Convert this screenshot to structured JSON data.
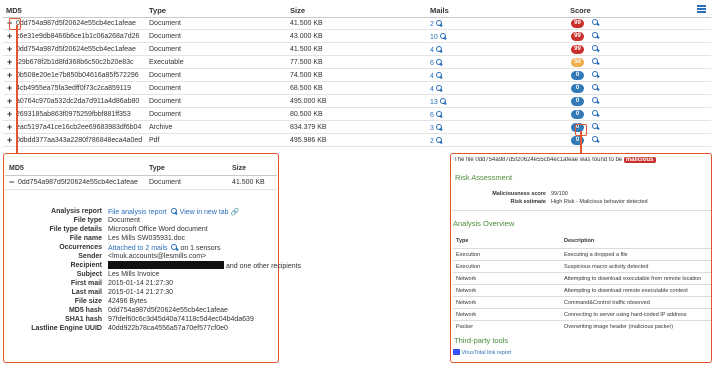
{
  "table": {
    "headers": {
      "md5": "MD5",
      "type": "Type",
      "size": "Size",
      "mails": "Mails",
      "score": "Score"
    },
    "rows": [
      {
        "md5": "0dd754a987d5f20624e55cb4ec1afeae",
        "type": "Document",
        "size": "41.500 KB",
        "mails": "2",
        "score": "99"
      },
      {
        "md5": "c6e31e9db8466b6ce1b1c06a268a7d26",
        "type": "Document",
        "size": "43.000 KB",
        "mails": "10",
        "score": "99"
      },
      {
        "md5": "0dd754a987d5f20624e55cb4ec1afeae",
        "type": "Document",
        "size": "41.500 KB",
        "mails": "4",
        "score": "99"
      },
      {
        "md5": "f29b678f2b1d8fd368b6c50c2b20e83c",
        "type": "Executable",
        "size": "77.500 KB",
        "mails": "6",
        "score": "50"
      },
      {
        "md5": "0b508e20e1e7b850b04616a85f572296",
        "type": "Document",
        "size": "74.500 KB",
        "mails": "4",
        "score": "0"
      },
      {
        "md5": "4cb4955ea75fa3edff0f73c2ca859119",
        "type": "Document",
        "size": "68.500 KB",
        "mails": "4",
        "score": "0"
      },
      {
        "md5": "a0764c970a532dc2da7d911a4d86ab80",
        "type": "Document",
        "size": "495.000 KB",
        "mails": "13",
        "score": "0"
      },
      {
        "md5": "2693185ab863f0975259fbbf881ff353",
        "type": "Document",
        "size": "80.500 KB",
        "mails": "6",
        "score": "0"
      },
      {
        "md5": "eac5197a41ce16cb2ee69683983df6b04",
        "type": "Archive",
        "size": "834.379 KB",
        "mails": "3",
        "score": "0"
      },
      {
        "md5": "0dbdd377aa343a2280f786848eca4a0ed",
        "type": "Pdf",
        "size": "495.986 KB",
        "mails": "2",
        "score": "0"
      }
    ]
  },
  "detail": {
    "headers": {
      "md5": "MD5",
      "type": "Type",
      "size": "Size"
    },
    "row": {
      "md5": "0dd754a987d5f20624e55cb4ec1afeae",
      "type": "Document",
      "size": "41.500 KB"
    },
    "analysis_report_label": "Analysis report",
    "analysis_report_link": "File analysis report",
    "view_new_tab": "View in new tab",
    "fields": [
      {
        "label": "File type",
        "value": "Document"
      },
      {
        "label": "File type details",
        "value": "Microsoft Office Word document"
      },
      {
        "label": "File name",
        "value": "Les Mills SW035931.doc"
      }
    ],
    "occurrences_label": "Occurrences",
    "occurrences_link": "Attached to 2 mails",
    "occurrences_suffix": "on 1 sensors",
    "sender_label": "Sender",
    "sender_value": "<lmuk.accounts@lesmills.com>",
    "recipient_label": "Recipient",
    "recipient_suffix": "and one other recipients",
    "fields2": [
      {
        "label": "Subject",
        "value": "Les Mills Invoice"
      },
      {
        "label": "First mail",
        "value": "2015-01-14 21:27:30"
      },
      {
        "label": "Last mail",
        "value": "2015-01-14 21:27:30"
      },
      {
        "label": "File size",
        "value": "42496 Bytes"
      },
      {
        "label": "MD5 hash",
        "value": "0dd754a987d5f20624e55cb4ec1afeae"
      },
      {
        "label": "SHA1 hash",
        "value": "97fdef60c6c3d45d40a74118c5d4ec04b4da639"
      },
      {
        "label": "Lastline Engine UUID",
        "value": "40dd922b78ca4556a57a70ef577cf0e0"
      }
    ]
  },
  "report": {
    "intro_prefix": "The file 0dd754a987d5f20624e55cb4ec1afeae was found to be",
    "verdict": "malicious",
    "risk_title": "Risk Assessment",
    "maliciousness_label": "Maliciousness score",
    "maliciousness_value": "99/100",
    "risk_estimate_label": "Risk estimate",
    "risk_estimate_value": "High Risk - Malicious behavior detected",
    "overview_title": "Analysis Overview",
    "overview_headers": {
      "type": "Type",
      "description": "Description"
    },
    "overview_rows": [
      {
        "type": "Execution",
        "description": "Executing a dropped a file"
      },
      {
        "type": "Execution",
        "description": "Suspicious macro activity detected"
      },
      {
        "type": "Network",
        "description": "Attempting to download executable from remote location"
      },
      {
        "type": "Network",
        "description": "Attempting to download remote executable content"
      },
      {
        "type": "Network",
        "description": "Command&Control traffic observed"
      },
      {
        "type": "Network",
        "description": "Connecting to server using hard-coded IP address"
      },
      {
        "type": "Packer",
        "description": "Overwriting image header (malicious packer)"
      }
    ],
    "third_party_title": "Third-party tools",
    "virustotal": "VirusTotal link report"
  },
  "colors": {
    "accent": "#2a6ebb",
    "callout_border": "#e2562d",
    "score_high": "#c9302c",
    "score_mid": "#f0ad4e",
    "score_low": "#337ab7",
    "section_green": "#4a8c3a"
  },
  "icons": {
    "expand": "plus-icon",
    "collapse": "minus-icon",
    "search": "magnifier-icon",
    "menu": "hamburger-icon",
    "external": "link-icon"
  }
}
